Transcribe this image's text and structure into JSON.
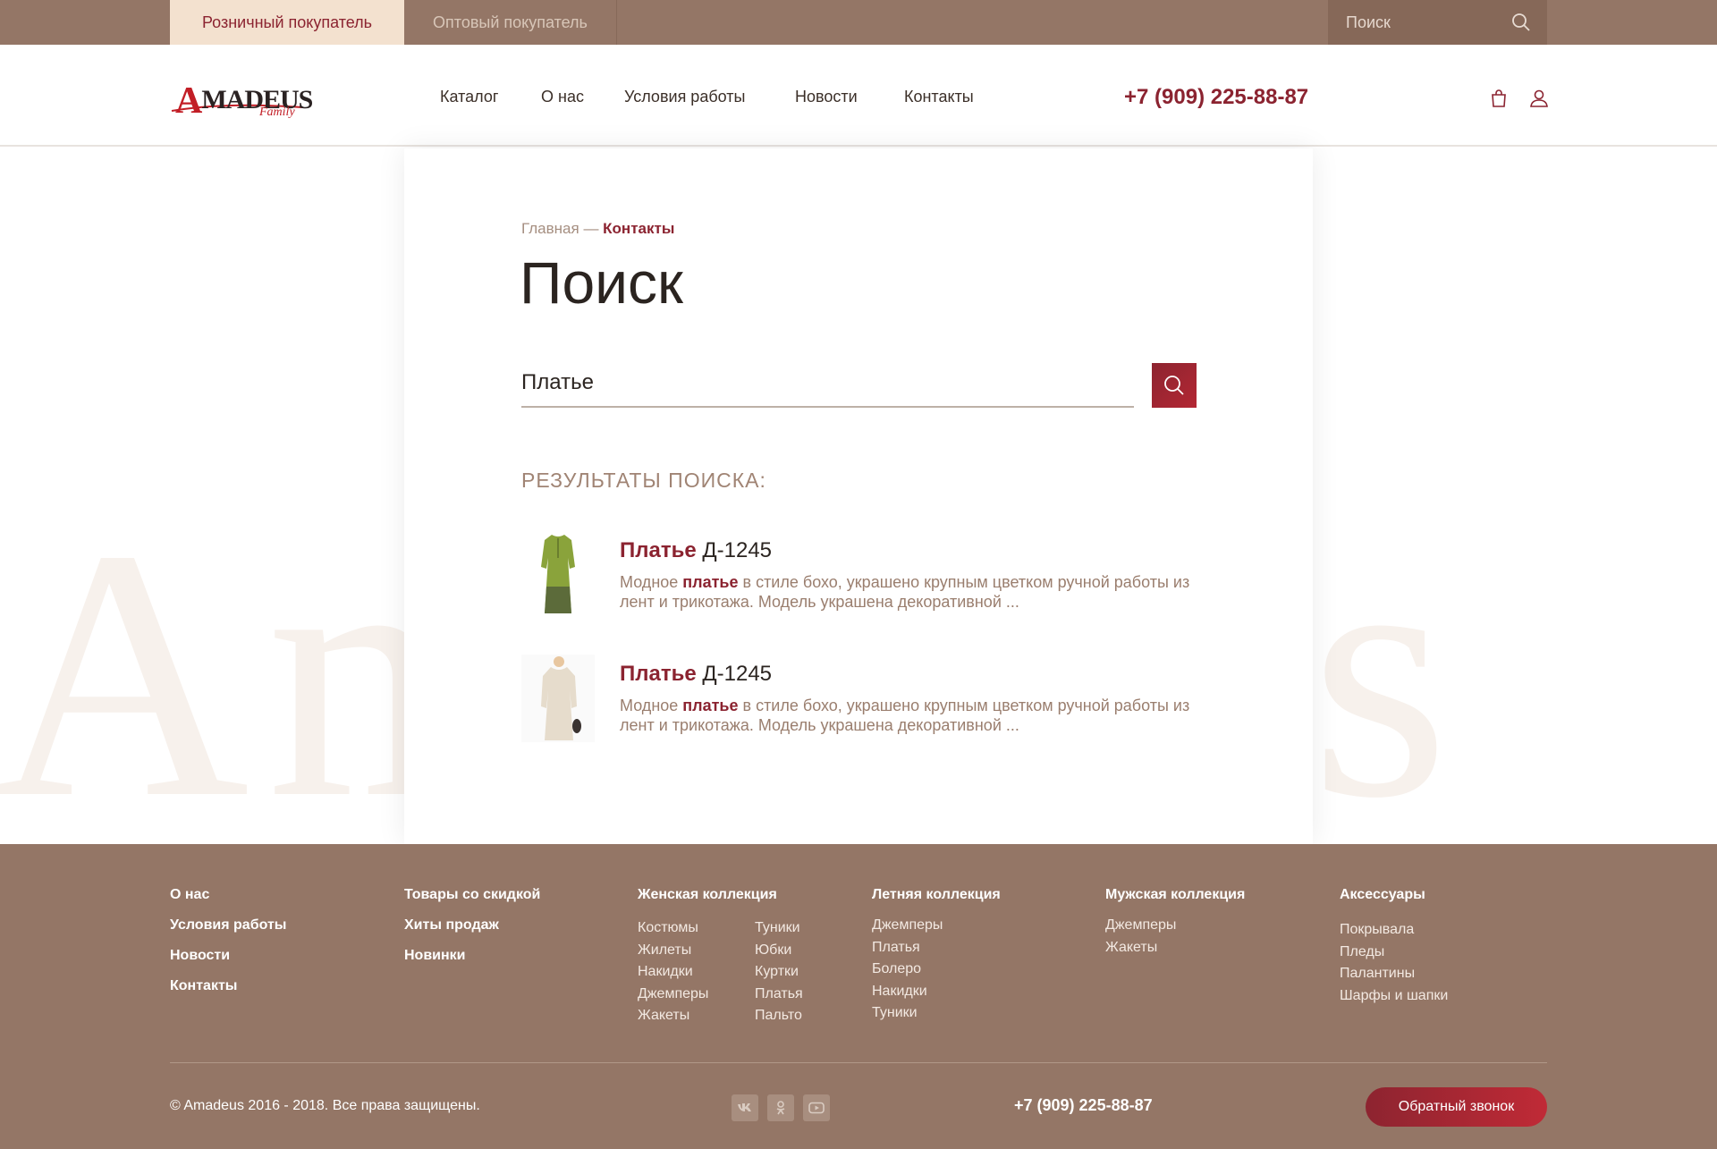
{
  "topbar": {
    "tabs": [
      {
        "label": "Розничный покупатель",
        "active": true
      },
      {
        "label": "Оптовый покупатель",
        "active": false
      }
    ],
    "search_placeholder": "Поиск"
  },
  "header": {
    "logo": {
      "word_initial": "A",
      "word_rest": "MADEUS",
      "sub": "Family"
    },
    "nav": [
      "Каталог",
      "О нас",
      "Условия работы",
      "Новости",
      "Контакты"
    ],
    "phone": "+7 (909) 225-88-87",
    "icons": [
      "cart-icon",
      "user-icon"
    ]
  },
  "watermark_text": "Amadeus",
  "main": {
    "breadcrumb": {
      "home": "Главная",
      "separator": " — ",
      "current": "Контакты"
    },
    "title": "Поиск",
    "search_value": "Платье",
    "results_title": "РЕЗУЛЬТАТЫ ПОИСКА:",
    "results": [
      {
        "title_highlight": "Платье",
        "title_rest": " Д-1245",
        "desc_before": "Модное ",
        "desc_highlight": "платье",
        "desc_after": " в стиле бохо, украшено крупным цветком ручной работы из лент и трикотажа. Модель украшена декоративной ..."
      },
      {
        "title_highlight": "Платье",
        "title_rest": " Д-1245",
        "desc_before": "Модное ",
        "desc_highlight": "платье",
        "desc_after": " в стиле бохо, украшено крупным цветком ручной работы из лент и трикотажа. Модель украшена декоративной ..."
      }
    ]
  },
  "footer": {
    "col1": [
      "О нас",
      "Условия работы",
      "Новости",
      "Контакты"
    ],
    "col2": [
      "Товары со скидкой",
      "Хиты продаж",
      "Новинки"
    ],
    "women": {
      "heading": "Женская коллекция",
      "list_a": [
        "Костюмы",
        "Жилеты",
        "Накидки",
        "Джемперы",
        "Жакеты"
      ],
      "list_b": [
        "Туники",
        "Юбки",
        "Куртки",
        "Платья",
        "Пальто"
      ]
    },
    "summer": {
      "heading": "Летняя коллекция",
      "list": [
        "Джемперы",
        "Платья",
        "Болеро",
        "Накидки",
        "Туники"
      ]
    },
    "men": {
      "heading": "Мужская коллекция",
      "list": [
        "Джемперы",
        "Жакеты"
      ]
    },
    "accessories": {
      "heading": "Аксессуары",
      "list": [
        "Покрывала",
        "Пледы",
        "Палантины",
        "Шарфы и шапки"
      ]
    },
    "copyright": "© Amadeus 2016 - 2018. Все права защищены.",
    "social": [
      "vk-icon",
      "odnoklassniki-icon",
      "youtube-icon"
    ],
    "phone": "+7 (909) 225-88-87",
    "callback_label": "Обратный звонок"
  },
  "colors": {
    "brand_dark_red": "#8b2330",
    "topbar_brown": "#947666",
    "retail_tab_bg": "#f3e1cf"
  }
}
